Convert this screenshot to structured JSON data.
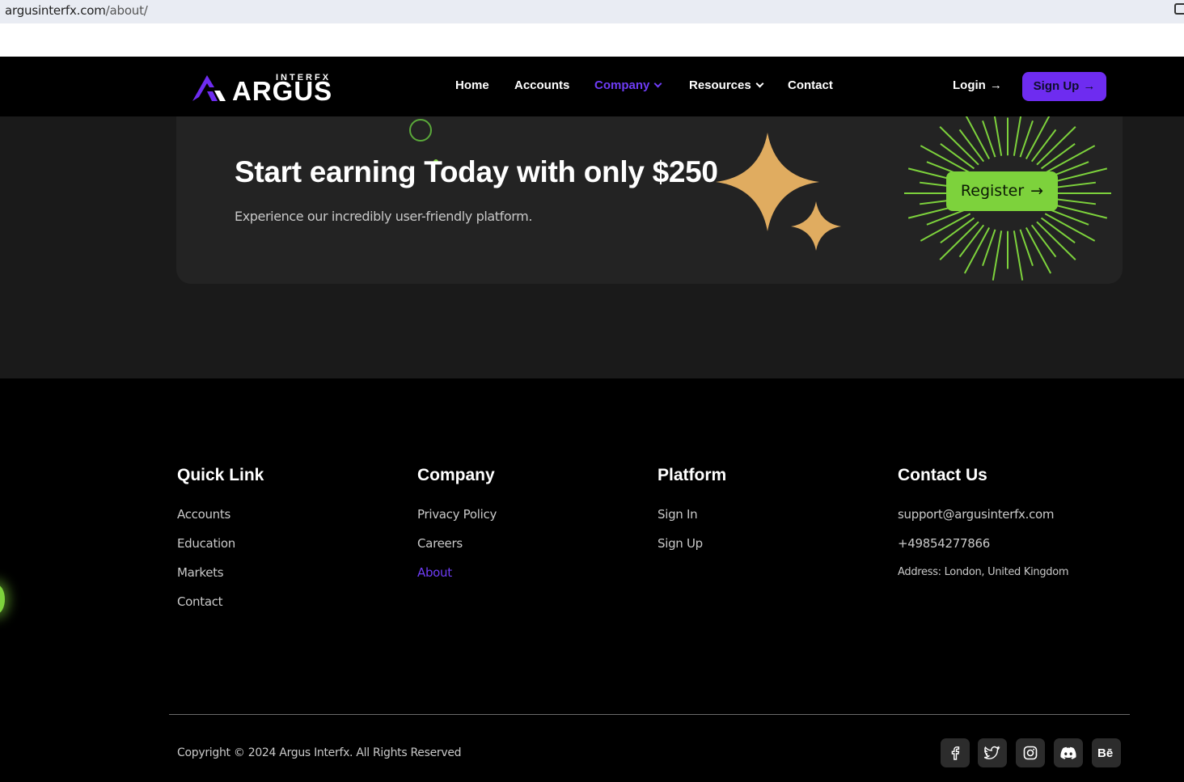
{
  "browser": {
    "url_host": "argusinterfx.com",
    "url_path": "/about/"
  },
  "header": {
    "logo_sub": "INTERFX",
    "logo_main": "ARGUS",
    "nav": [
      "Home",
      "Accounts",
      "Company",
      "Resources",
      "Contact"
    ],
    "active_nav": "Company",
    "login_label": "Login",
    "signup_label": "Sign Up"
  },
  "cta": {
    "title": "Start earning Today with only $250",
    "subtitle": "Experience our incredibly user-friendly platform.",
    "button_label": "Register"
  },
  "footer": {
    "quick_link": {
      "heading": "Quick Link",
      "items": [
        "Accounts",
        "Education",
        "Markets",
        "Contact"
      ]
    },
    "company": {
      "heading": "Company",
      "items": [
        "Privacy Policy",
        "Careers",
        "About"
      ],
      "active": "About"
    },
    "platform": {
      "heading": "Platform",
      "items": [
        "Sign In",
        "Sign Up"
      ]
    },
    "contact": {
      "heading": "Contact Us",
      "email": "support@argusinterfx.com",
      "phone": "+49854277866",
      "address": "Address: London, United Kingdom"
    },
    "copyright": "Copyright © 2024 Argus Interfx. All Rights Reserved",
    "social_icons": [
      "facebook-icon",
      "twitter-icon",
      "instagram-icon",
      "discord-icon",
      "behance-icon"
    ]
  },
  "colors": {
    "accent_purple": "#6e2cf0",
    "accent_green": "#7dd23c",
    "star_gold": "#e0ac60"
  }
}
